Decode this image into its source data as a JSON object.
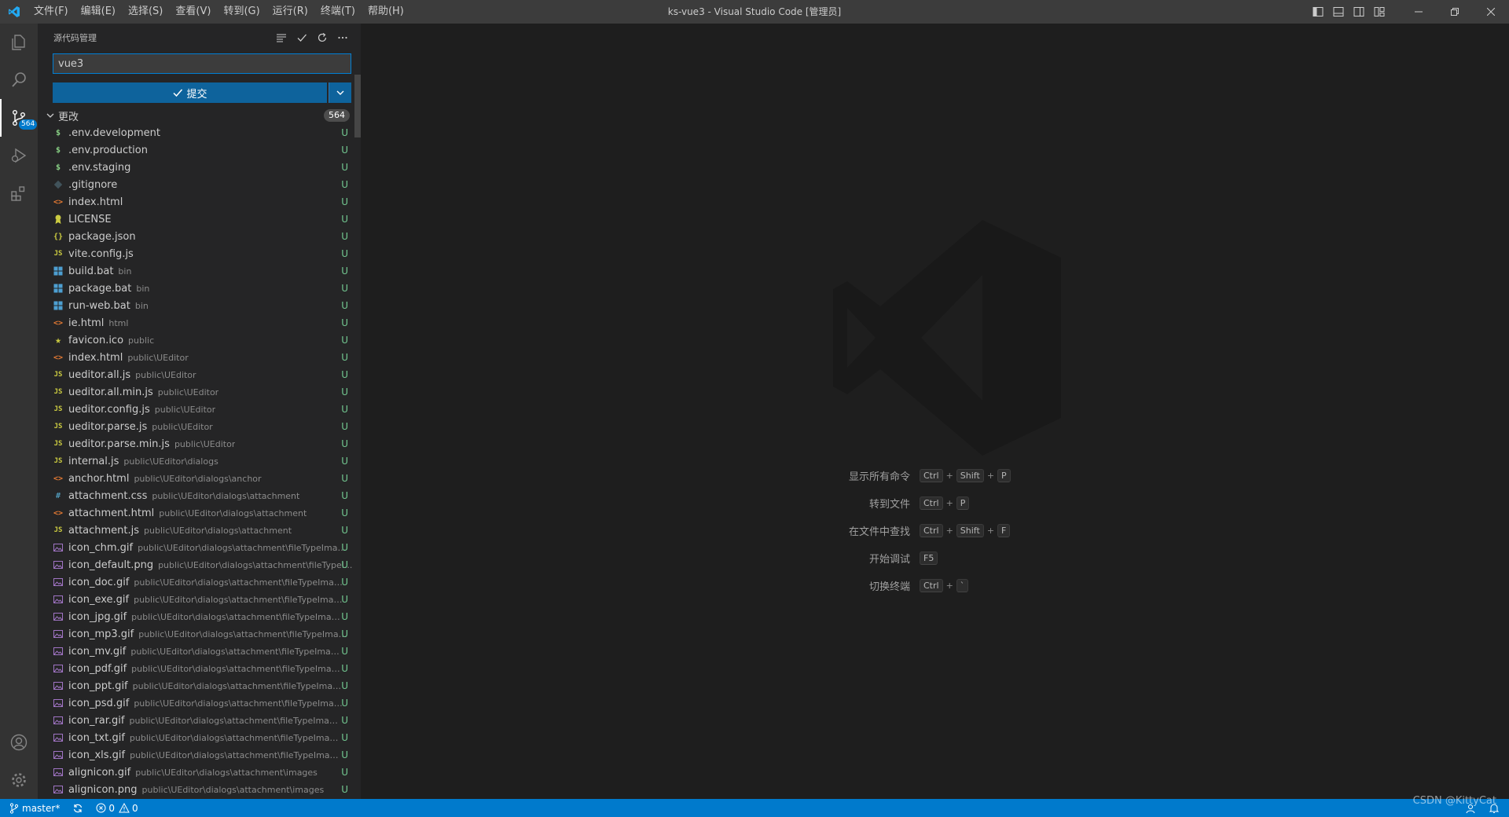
{
  "titlebar": {
    "menus": [
      "文件(F)",
      "编辑(E)",
      "选择(S)",
      "查看(V)",
      "转到(G)",
      "运行(R)",
      "终端(T)",
      "帮助(H)"
    ],
    "title": "ks-vue3 - Visual Studio Code [管理员]"
  },
  "activity": {
    "scm_badge": "564"
  },
  "scm": {
    "header": "源代码管理",
    "commit_message": "vue3",
    "commit_label": "提交",
    "changes_label": "更改",
    "changes_count": "564",
    "files": [
      {
        "name": ".env.development",
        "path": "",
        "icon": "dollar",
        "status": "U"
      },
      {
        "name": ".env.production",
        "path": "",
        "icon": "dollar",
        "status": "U"
      },
      {
        "name": ".env.staging",
        "path": "",
        "icon": "dollar",
        "status": "U"
      },
      {
        "name": ".gitignore",
        "path": "",
        "icon": "git",
        "status": "U"
      },
      {
        "name": "index.html",
        "path": "",
        "icon": "html",
        "status": "U"
      },
      {
        "name": "LICENSE",
        "path": "",
        "icon": "license",
        "status": "U"
      },
      {
        "name": "package.json",
        "path": "",
        "icon": "json",
        "status": "U"
      },
      {
        "name": "vite.config.js",
        "path": "",
        "icon": "js",
        "status": "U"
      },
      {
        "name": "build.bat",
        "path": "bin",
        "icon": "windows",
        "status": "U"
      },
      {
        "name": "package.bat",
        "path": "bin",
        "icon": "windows",
        "status": "U"
      },
      {
        "name": "run-web.bat",
        "path": "bin",
        "icon": "windows",
        "status": "U"
      },
      {
        "name": "ie.html",
        "path": "html",
        "icon": "html",
        "status": "U"
      },
      {
        "name": "favicon.ico",
        "path": "public",
        "icon": "star",
        "status": "U"
      },
      {
        "name": "index.html",
        "path": "public\\UEditor",
        "icon": "html",
        "status": "U"
      },
      {
        "name": "ueditor.all.js",
        "path": "public\\UEditor",
        "icon": "js",
        "status": "U"
      },
      {
        "name": "ueditor.all.min.js",
        "path": "public\\UEditor",
        "icon": "js",
        "status": "U"
      },
      {
        "name": "ueditor.config.js",
        "path": "public\\UEditor",
        "icon": "js",
        "status": "U"
      },
      {
        "name": "ueditor.parse.js",
        "path": "public\\UEditor",
        "icon": "js",
        "status": "U"
      },
      {
        "name": "ueditor.parse.min.js",
        "path": "public\\UEditor",
        "icon": "js",
        "status": "U"
      },
      {
        "name": "internal.js",
        "path": "public\\UEditor\\dialogs",
        "icon": "js",
        "status": "U"
      },
      {
        "name": "anchor.html",
        "path": "public\\UEditor\\dialogs\\anchor",
        "icon": "html",
        "status": "U"
      },
      {
        "name": "attachment.css",
        "path": "public\\UEditor\\dialogs\\attachment",
        "icon": "css",
        "status": "U"
      },
      {
        "name": "attachment.html",
        "path": "public\\UEditor\\dialogs\\attachment",
        "icon": "html",
        "status": "U"
      },
      {
        "name": "attachment.js",
        "path": "public\\UEditor\\dialogs\\attachment",
        "icon": "js",
        "status": "U"
      },
      {
        "name": "icon_chm.gif",
        "path": "public\\UEditor\\dialogs\\attachment\\fileTypeImages",
        "icon": "image",
        "status": "U"
      },
      {
        "name": "icon_default.png",
        "path": "public\\UEditor\\dialogs\\attachment\\fileTypel...",
        "icon": "image",
        "status": "U"
      },
      {
        "name": "icon_doc.gif",
        "path": "public\\UEditor\\dialogs\\attachment\\fileTypeImages",
        "icon": "image",
        "status": "U"
      },
      {
        "name": "icon_exe.gif",
        "path": "public\\UEditor\\dialogs\\attachment\\fileTypeImages",
        "icon": "image",
        "status": "U"
      },
      {
        "name": "icon_jpg.gif",
        "path": "public\\UEditor\\dialogs\\attachment\\fileTypeImages",
        "icon": "image",
        "status": "U"
      },
      {
        "name": "icon_mp3.gif",
        "path": "public\\UEditor\\dialogs\\attachment\\fileTypeImages",
        "icon": "image",
        "status": "U"
      },
      {
        "name": "icon_mv.gif",
        "path": "public\\UEditor\\dialogs\\attachment\\fileTypeImages",
        "icon": "image",
        "status": "U"
      },
      {
        "name": "icon_pdf.gif",
        "path": "public\\UEditor\\dialogs\\attachment\\fileTypeImages",
        "icon": "image",
        "status": "U"
      },
      {
        "name": "icon_ppt.gif",
        "path": "public\\UEditor\\dialogs\\attachment\\fileTypeImages",
        "icon": "image",
        "status": "U"
      },
      {
        "name": "icon_psd.gif",
        "path": "public\\UEditor\\dialogs\\attachment\\fileTypeImages",
        "icon": "image",
        "status": "U"
      },
      {
        "name": "icon_rar.gif",
        "path": "public\\UEditor\\dialogs\\attachment\\fileTypeImages",
        "icon": "image",
        "status": "U"
      },
      {
        "name": "icon_txt.gif",
        "path": "public\\UEditor\\dialogs\\attachment\\fileTypeImages",
        "icon": "image",
        "status": "U"
      },
      {
        "name": "icon_xls.gif",
        "path": "public\\UEditor\\dialogs\\attachment\\fileTypeImages",
        "icon": "image",
        "status": "U"
      },
      {
        "name": "alignicon.gif",
        "path": "public\\UEditor\\dialogs\\attachment\\images",
        "icon": "image",
        "status": "U"
      },
      {
        "name": "alignicon.png",
        "path": "public\\UEditor\\dialogs\\attachment\\images",
        "icon": "image",
        "status": "U"
      }
    ]
  },
  "shortcuts": [
    {
      "label": "显示所有命令",
      "keys": [
        "Ctrl",
        "Shift",
        "P"
      ]
    },
    {
      "label": "转到文件",
      "keys": [
        "Ctrl",
        "P"
      ]
    },
    {
      "label": "在文件中查找",
      "keys": [
        "Ctrl",
        "Shift",
        "F"
      ]
    },
    {
      "label": "开始调试",
      "keys": [
        "F5"
      ]
    },
    {
      "label": "切换终端",
      "keys": [
        "Ctrl",
        "`"
      ]
    }
  ],
  "statusbar": {
    "branch": "master*",
    "errors": "0",
    "warnings": "0"
  },
  "watermark_text": "CSDN @KittyCat",
  "colors": {
    "accent": "#007acc",
    "untracked": "#73c991",
    "js": "#cbcb41",
    "html": "#e37933",
    "css": "#519aba",
    "image": "#a074c4",
    "windows": "#4d9fd1"
  }
}
